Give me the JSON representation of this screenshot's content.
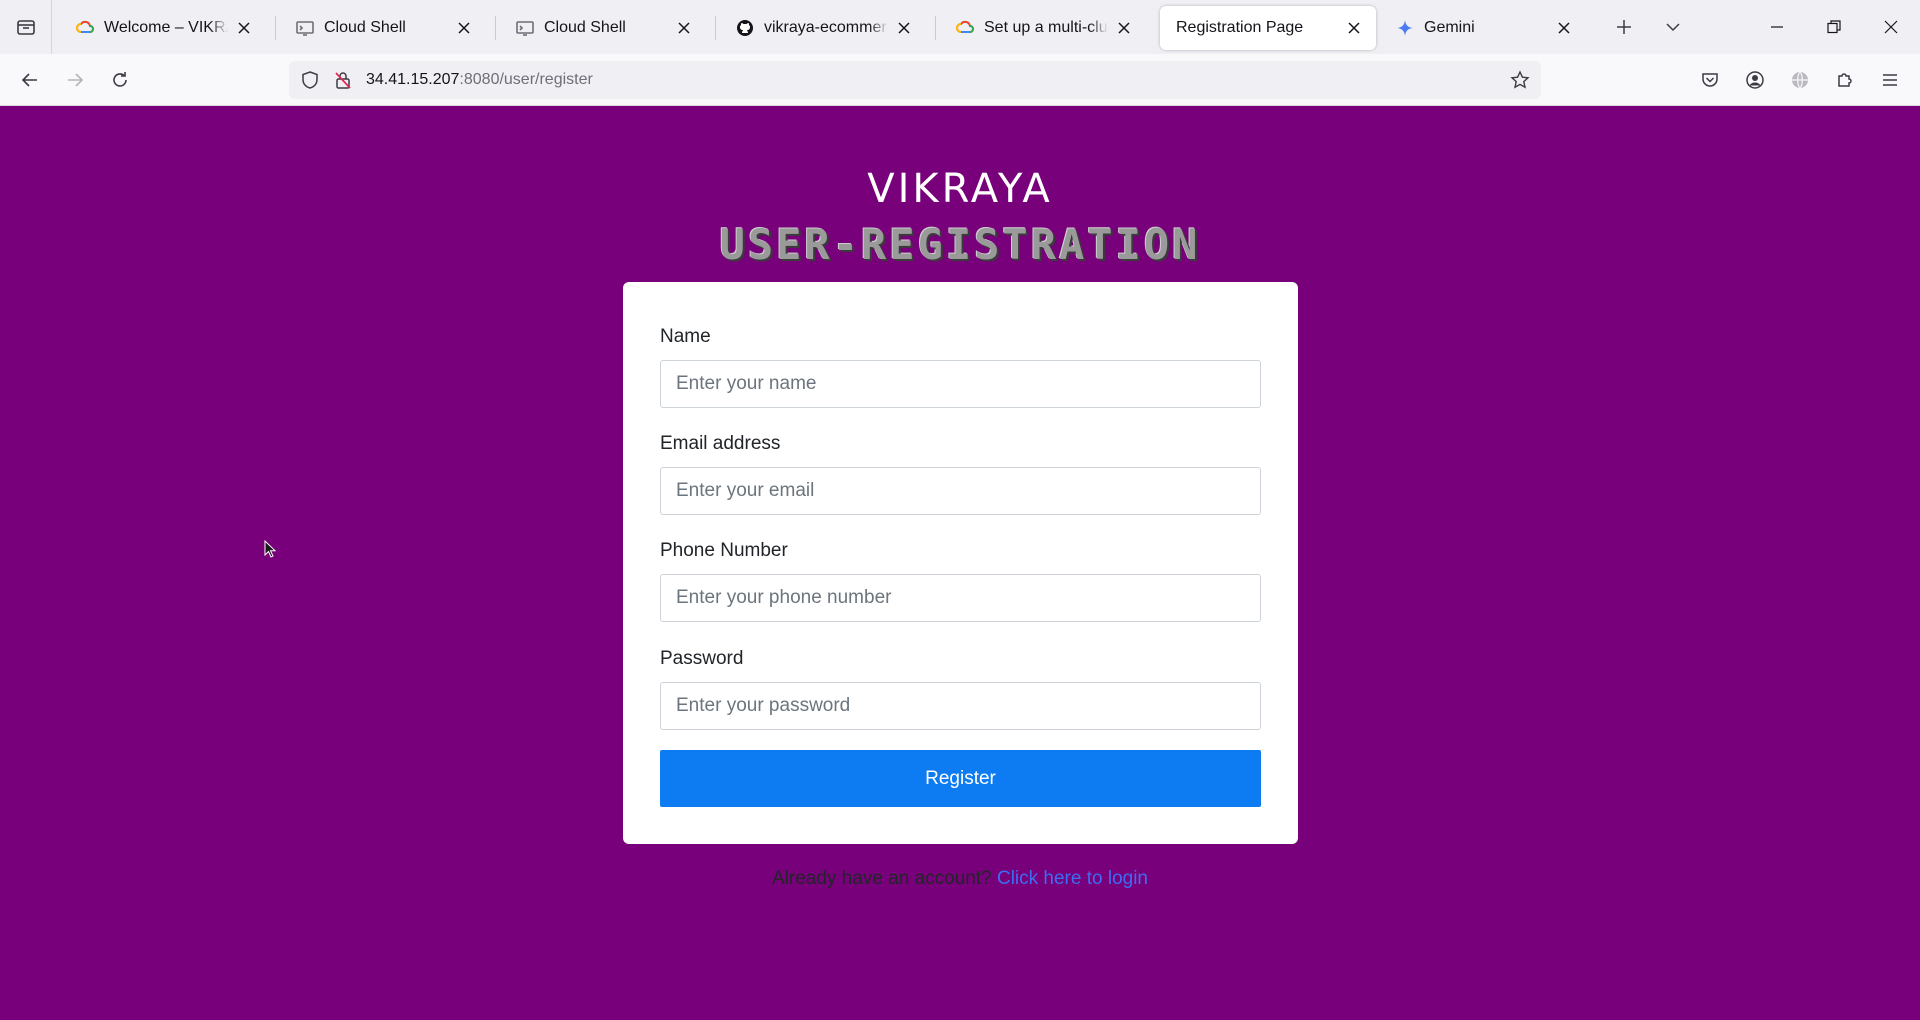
{
  "browser": {
    "tabs": [
      {
        "title": "Welcome – VIKRAYA-D",
        "icon": "google-cloud-icon",
        "active": false
      },
      {
        "title": "Cloud Shell",
        "icon": "cloud-shell-icon",
        "active": false
      },
      {
        "title": "Cloud Shell",
        "icon": "cloud-shell-icon",
        "active": false
      },
      {
        "title": "vikraya-ecommerce/se",
        "icon": "github-icon",
        "active": false
      },
      {
        "title": "Set up a multi-cluster I",
        "icon": "google-cloud-icon",
        "active": false
      },
      {
        "title": "Registration Page",
        "icon": "",
        "active": true
      },
      {
        "title": "Gemini",
        "icon": "gemini-icon",
        "active": false
      }
    ],
    "url": {
      "host": "34.41.15.207",
      "rest": ":8080/user/register"
    }
  },
  "page": {
    "brand": "VIKRAYA",
    "subtitle": "USER-REGISTRATION",
    "form": {
      "name": {
        "label": "Name",
        "placeholder": "Enter your name",
        "value": ""
      },
      "email": {
        "label": "Email address",
        "placeholder": "Enter your email",
        "value": ""
      },
      "phone": {
        "label": "Phone Number",
        "placeholder": "Enter your phone number",
        "value": ""
      },
      "password": {
        "label": "Password",
        "placeholder": "Enter your password",
        "value": ""
      },
      "submit_label": "Register"
    },
    "login_prompt": "Already have an account?",
    "login_link": "Click here to login"
  },
  "colors": {
    "background": "#78007a",
    "button": "#0d7cf2",
    "link": "#3b6df5"
  }
}
